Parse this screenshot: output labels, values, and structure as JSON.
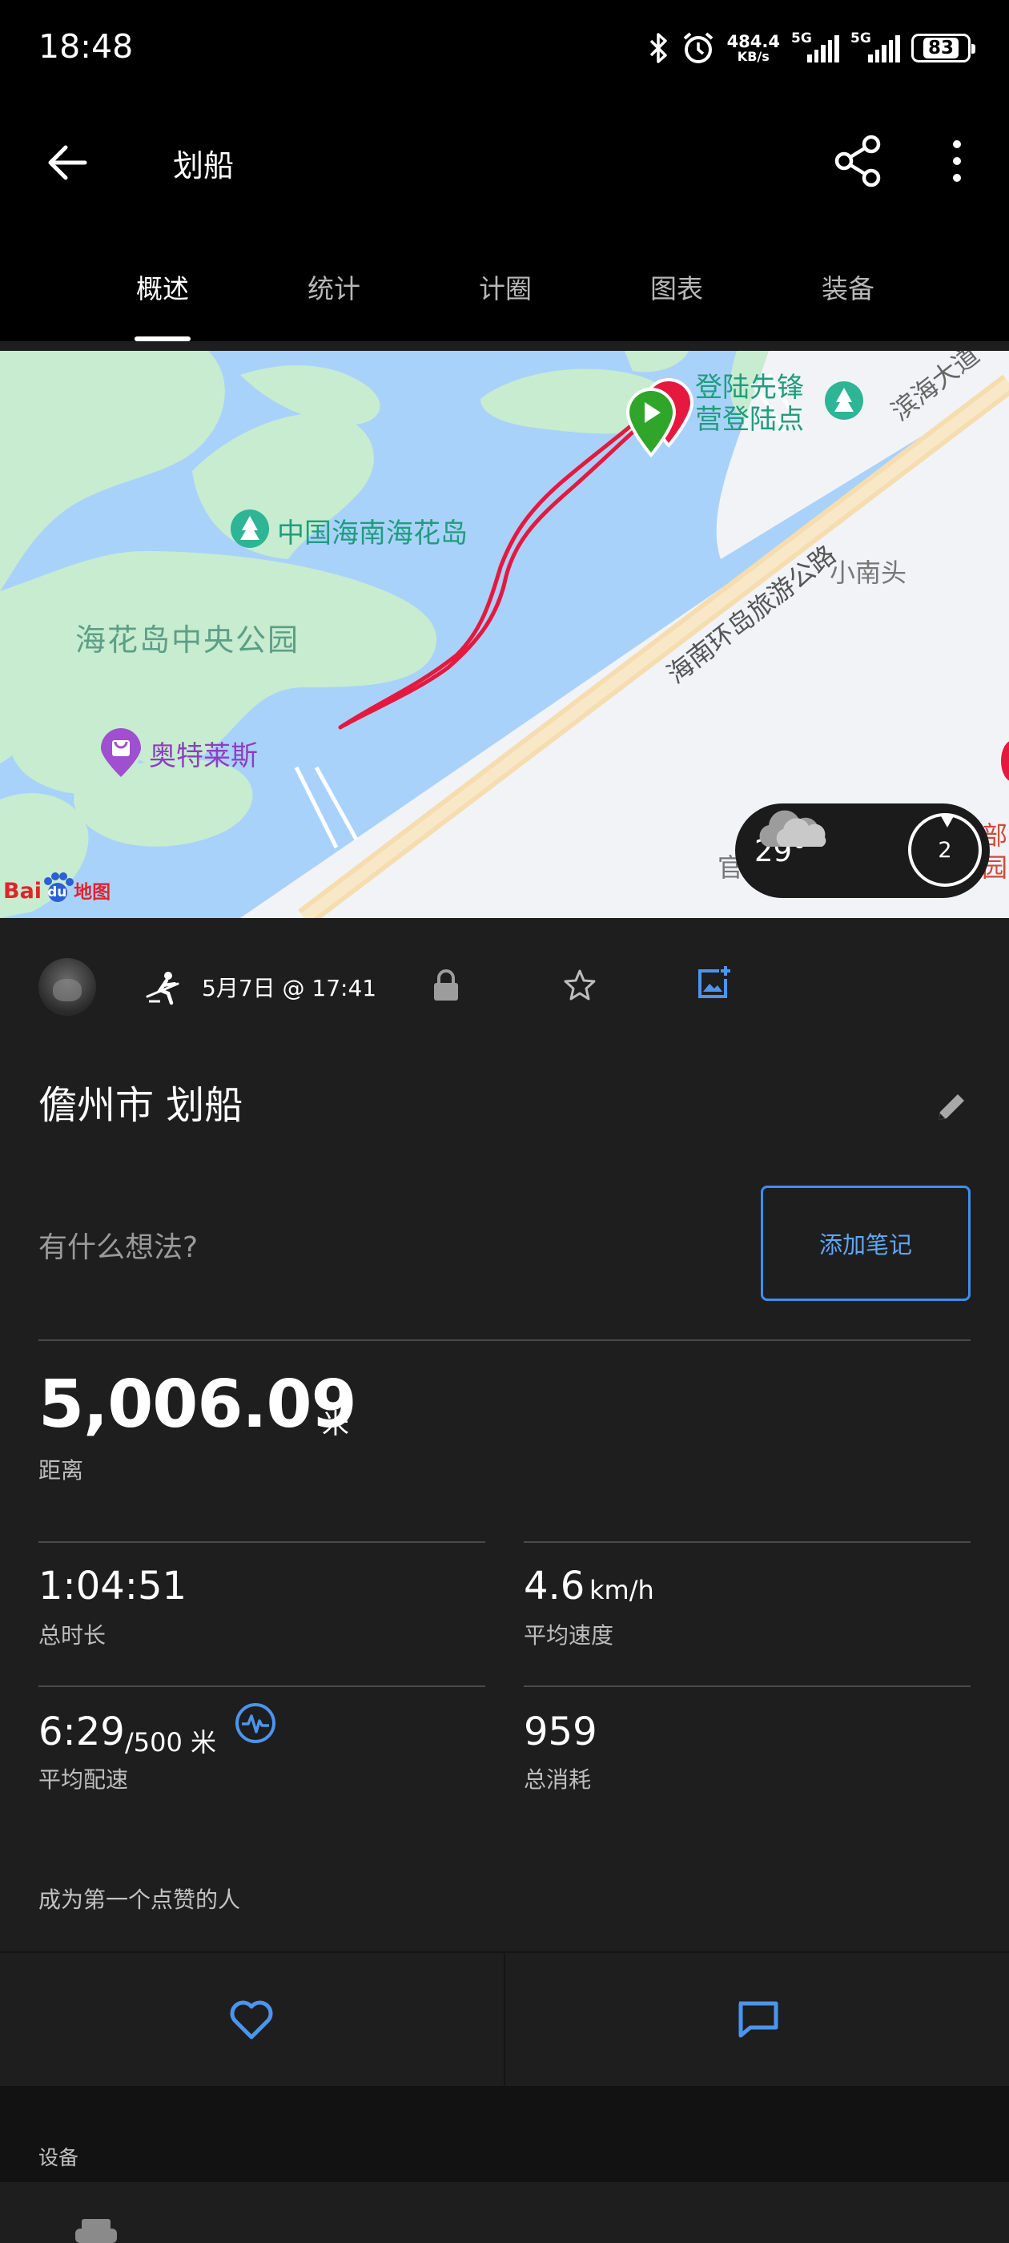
{
  "status_bar": {
    "time": "18:48",
    "net_speed_value": "484.4",
    "net_speed_unit": "KB/s",
    "signal1_label": "5G",
    "signal2_label": "5G",
    "battery": "83"
  },
  "app_bar": {
    "title": "划船"
  },
  "tabs": [
    {
      "label": "概述",
      "active": true
    },
    {
      "label": "统计",
      "active": false
    },
    {
      "label": "计圈",
      "active": false
    },
    {
      "label": "图表",
      "active": false
    },
    {
      "label": "装备",
      "active": false
    }
  ],
  "map": {
    "labels": {
      "poi_landing_1": "登陆先锋",
      "poi_landing_2": "营登陆点",
      "road_coast_1": "滨海大道",
      "road_ring": "海南环岛旅游公路",
      "island": "中国海南海花岛",
      "park": "海花岛中央公园",
      "village": "小南头",
      "outlets": "奥特莱斯",
      "partial_right_1": "部",
      "partial_right_2": "园",
      "partial_left": "官"
    },
    "weather": {
      "temperature": "29°",
      "badge": "2"
    },
    "logo_text_1": "Bai",
    "logo_text_2": "du",
    "logo_text_3": "地图",
    "colors": {
      "water": "#a9d2fb",
      "land": "#c7ecd0",
      "route": "#e5193f"
    }
  },
  "activity": {
    "date": "5月7日 @ 17:41",
    "title": "儋州市 划船",
    "notes_placeholder": "有什么想法?",
    "add_note_label": "添加笔记"
  },
  "stats": {
    "distance": {
      "value": "5,006.09",
      "unit": "米",
      "label": "距离"
    },
    "duration": {
      "value": "1:04:51",
      "label": "总时长"
    },
    "avg_speed": {
      "value": "4.6",
      "unit": "km/h",
      "label": "平均速度"
    },
    "avg_pace": {
      "value": "6:29",
      "unit": "/500 米",
      "label": "平均配速"
    },
    "calories": {
      "value": "959",
      "label": "总消耗"
    }
  },
  "social": {
    "kudos_text": "成为第一个点赞的人"
  },
  "devices": {
    "section_label": "设备"
  },
  "accent_color": "#3e8ef0"
}
